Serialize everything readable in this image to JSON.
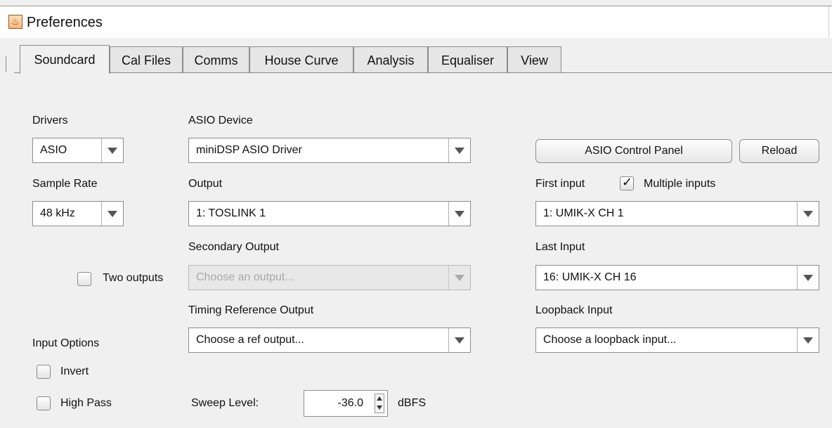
{
  "window": {
    "title": "Preferences",
    "icon": "java-cup-icon"
  },
  "tabs": [
    {
      "label": "Soundcard",
      "active": true
    },
    {
      "label": "Cal Files"
    },
    {
      "label": "Comms"
    },
    {
      "label": "House Curve"
    },
    {
      "label": "Analysis"
    },
    {
      "label": "Equaliser"
    },
    {
      "label": "View"
    }
  ],
  "soundcard": {
    "drivers_label": "Drivers",
    "drivers_value": "ASIO",
    "asio_device_label": "ASIO Device",
    "asio_device_value": "miniDSP ASIO Driver",
    "asio_control_panel_button": "ASIO Control Panel",
    "reload_button": "Reload",
    "sample_rate_label": "Sample Rate",
    "sample_rate_value": "48 kHz",
    "output_label": "Output",
    "output_value": "1: TOSLINK 1",
    "first_input_label": "First input",
    "multiple_inputs_label": "Multiple inputs",
    "multiple_inputs_checked": true,
    "first_input_value": "1: UMIK-X CH 1",
    "secondary_output_label": "Secondary Output",
    "two_outputs_label": "Two outputs",
    "two_outputs_checked": false,
    "secondary_output_placeholder": "Choose an output...",
    "last_input_label": "Last Input",
    "last_input_value": "16: UMIK-X CH 16",
    "timing_ref_label": "Timing Reference Output",
    "timing_ref_value": "Choose a ref output...",
    "loopback_label": "Loopback Input",
    "loopback_value": "Choose a loopback input...",
    "input_options_label": "Input Options",
    "invert_label": "Invert",
    "invert_checked": false,
    "high_pass_label": "High Pass",
    "high_pass_checked": false,
    "sweep_level_label": "Sweep Level:",
    "sweep_level_value": "-36.0",
    "sweep_level_unit": "dBFS"
  }
}
